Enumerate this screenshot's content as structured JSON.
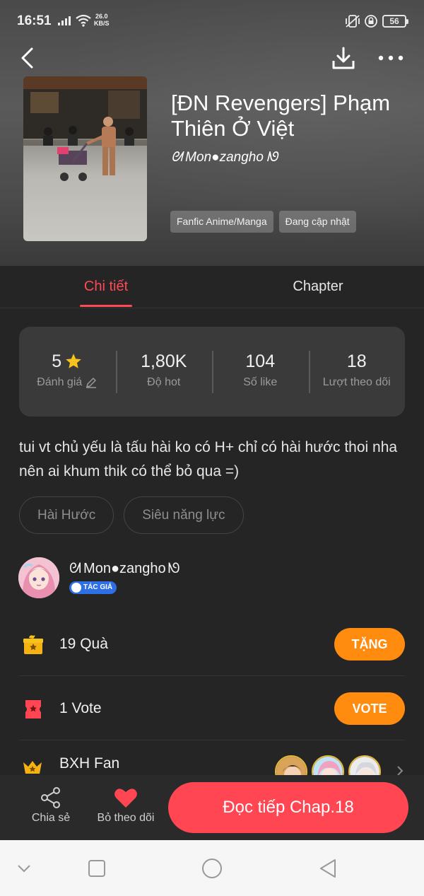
{
  "status_bar": {
    "time": "16:51",
    "speed_value": "26.0",
    "speed_unit": "KB/S",
    "battery": "56"
  },
  "header": {
    "title": "[ĐN Revengers] Phạm Thiên Ở Việt",
    "author": "Mon●zangho",
    "tags": [
      "Fanfic Anime/Manga",
      "Đang cập nhật"
    ]
  },
  "tabs": {
    "detail": "Chi tiết",
    "chapter": "Chapter"
  },
  "stats": {
    "rating_value": "5",
    "rating_label": "Đánh giá",
    "hot_value": "1,80K",
    "hot_label": "Độ hot",
    "likes_value": "104",
    "likes_label": "Số like",
    "follows_value": "18",
    "follows_label": "Lượt theo dõi"
  },
  "description": "tui vt chủ yếu là tấu hài ko có H+ chỉ có hài hước thoi nha nên ai khum thik có thể bỏ qua =)",
  "genres": [
    "Hài Hước",
    "Siêu năng lực"
  ],
  "author_section": {
    "name": "Mon●zangho",
    "badge": "TÁC GIẢ"
  },
  "gifts": {
    "label": "19  Quà",
    "button": "TẶNG"
  },
  "votes": {
    "label": "1  Vote",
    "button": "VOTE"
  },
  "fans": {
    "label": "BXH Fan"
  },
  "action_bar": {
    "share": "Chia sẻ",
    "unfollow": "Bỏ theo dõi",
    "read": "Đọc tiếp Chap.18"
  },
  "colors": {
    "accent": "#ff4a55",
    "orange": "#ff8b0f",
    "background": "#252525",
    "card": "#3a3a3a"
  }
}
